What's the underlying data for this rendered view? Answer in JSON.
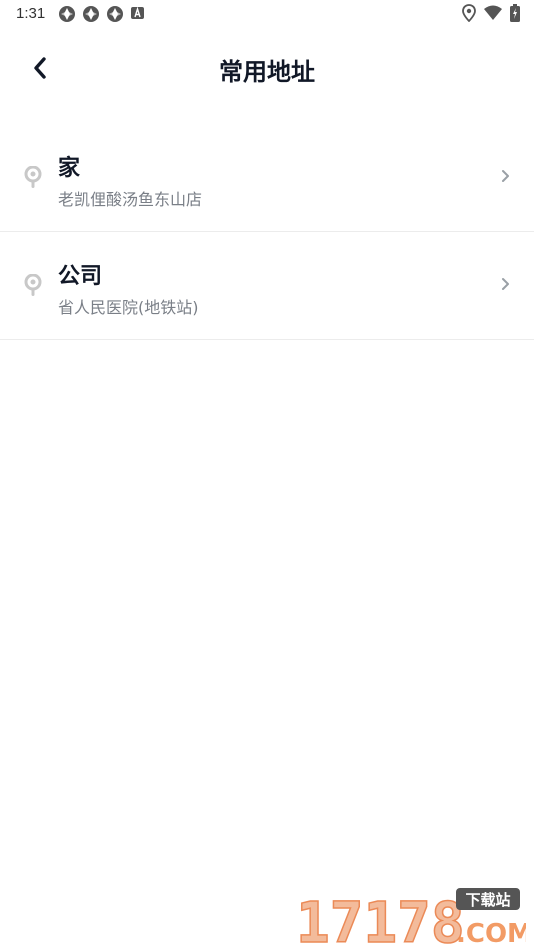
{
  "status_bar": {
    "time": "1:31",
    "left_icons": [
      "app-notification-icon",
      "app-notification-icon",
      "app-notification-icon",
      "keyboard-a-icon"
    ],
    "right_icons": [
      "location-icon",
      "wifi-icon",
      "battery-charging-icon"
    ]
  },
  "header": {
    "title": "常用地址",
    "back_icon": "chevron-left-icon"
  },
  "addresses": [
    {
      "name": "家",
      "address": "老凯俚酸汤鱼东山店"
    },
    {
      "name": "公司",
      "address": "省人民医院(地铁站)"
    }
  ],
  "watermark": {
    "text": "17178",
    "tag": "下载站",
    "suffix": ".COM"
  },
  "colors": {
    "title": "#111827",
    "subtitle": "#7a7f87",
    "icon_gray": "#c8c8c8",
    "divider": "#ececec",
    "watermark_orange": "#f08a4b"
  }
}
